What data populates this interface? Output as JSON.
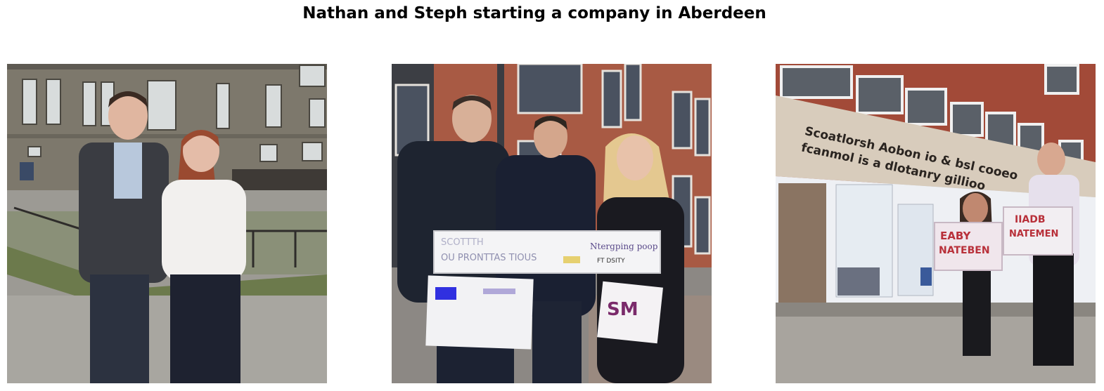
{
  "figure": {
    "title": "Nathan and Steph starting a company in Aberdeen"
  },
  "panels": [
    {
      "scene": "tenement-street",
      "people": 2
    },
    {
      "scene": "red-brick-street",
      "people": 3,
      "sign_text": [
        "SCOTTTH",
        "OU PRONTTAS TIOUS",
        "Ntergping poop",
        "FT DSITY"
      ]
    },
    {
      "scene": "shopfront",
      "people": 2,
      "facade_text": [
        "Scoatlorsh Aobon io & bsl cooeo",
        "fcanmol is a dlotanry gillioo"
      ],
      "sign_text": [
        "EABY",
        "NATEBEN",
        "IIADB",
        "NATEMEN"
      ]
    }
  ],
  "colors": {
    "background": "#ffffff",
    "title": "#000000"
  }
}
